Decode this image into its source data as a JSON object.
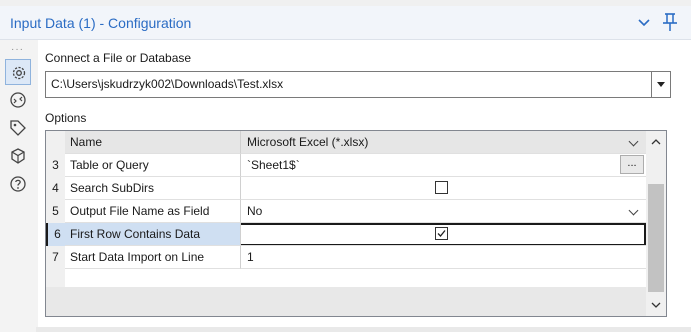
{
  "header": {
    "title": "Input Data (1) - Configuration"
  },
  "toolbar": {
    "icons": [
      "gear-icon",
      "connection-icon",
      "tag-icon",
      "cube-icon",
      "help-icon"
    ]
  },
  "connect": {
    "label": "Connect a File or Database",
    "path": "C:\\Users\\jskudrzyk002\\Downloads\\Test.xlsx"
  },
  "options": {
    "label": "Options",
    "header_row": {
      "name": "Name",
      "value": "Microsoft Excel (*.xlsx)"
    },
    "rows": [
      {
        "num": "3",
        "name": "Table or Query",
        "value": "`Sheet1$`",
        "ellipsis": "..."
      },
      {
        "num": "4",
        "name": "Search SubDirs",
        "checked": false
      },
      {
        "num": "5",
        "name": "Output File Name as Field",
        "value": "No"
      },
      {
        "num": "6",
        "name": "First Row Contains Data",
        "checked": true
      },
      {
        "num": "7",
        "name": "Start Data Import on Line",
        "value": "1"
      }
    ]
  },
  "colors": {
    "accent": "#2b6cc4",
    "selection": "#cfdff2"
  }
}
